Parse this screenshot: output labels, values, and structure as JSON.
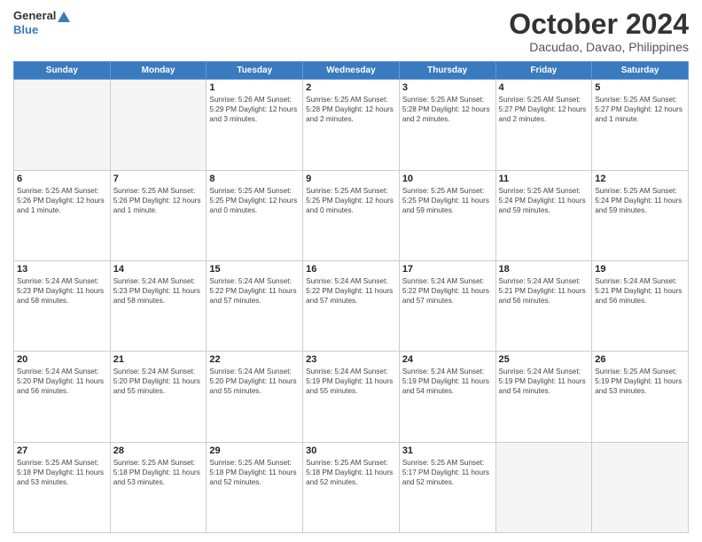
{
  "header": {
    "logo_line1": "General",
    "logo_line2": "Blue",
    "month": "October 2024",
    "location": "Dacudao, Davao, Philippines"
  },
  "weekdays": [
    "Sunday",
    "Monday",
    "Tuesday",
    "Wednesday",
    "Thursday",
    "Friday",
    "Saturday"
  ],
  "weeks": [
    [
      {
        "day": "",
        "info": ""
      },
      {
        "day": "",
        "info": ""
      },
      {
        "day": "1",
        "info": "Sunrise: 5:26 AM\nSunset: 5:29 PM\nDaylight: 12 hours\nand 3 minutes."
      },
      {
        "day": "2",
        "info": "Sunrise: 5:25 AM\nSunset: 5:28 PM\nDaylight: 12 hours\nand 2 minutes."
      },
      {
        "day": "3",
        "info": "Sunrise: 5:25 AM\nSunset: 5:28 PM\nDaylight: 12 hours\nand 2 minutes."
      },
      {
        "day": "4",
        "info": "Sunrise: 5:25 AM\nSunset: 5:27 PM\nDaylight: 12 hours\nand 2 minutes."
      },
      {
        "day": "5",
        "info": "Sunrise: 5:25 AM\nSunset: 5:27 PM\nDaylight: 12 hours\nand 1 minute."
      }
    ],
    [
      {
        "day": "6",
        "info": "Sunrise: 5:25 AM\nSunset: 5:26 PM\nDaylight: 12 hours\nand 1 minute."
      },
      {
        "day": "7",
        "info": "Sunrise: 5:25 AM\nSunset: 5:26 PM\nDaylight: 12 hours\nand 1 minute."
      },
      {
        "day": "8",
        "info": "Sunrise: 5:25 AM\nSunset: 5:25 PM\nDaylight: 12 hours\nand 0 minutes."
      },
      {
        "day": "9",
        "info": "Sunrise: 5:25 AM\nSunset: 5:25 PM\nDaylight: 12 hours\nand 0 minutes."
      },
      {
        "day": "10",
        "info": "Sunrise: 5:25 AM\nSunset: 5:25 PM\nDaylight: 11 hours\nand 59 minutes."
      },
      {
        "day": "11",
        "info": "Sunrise: 5:25 AM\nSunset: 5:24 PM\nDaylight: 11 hours\nand 59 minutes."
      },
      {
        "day": "12",
        "info": "Sunrise: 5:25 AM\nSunset: 5:24 PM\nDaylight: 11 hours\nand 59 minutes."
      }
    ],
    [
      {
        "day": "13",
        "info": "Sunrise: 5:24 AM\nSunset: 5:23 PM\nDaylight: 11 hours\nand 58 minutes."
      },
      {
        "day": "14",
        "info": "Sunrise: 5:24 AM\nSunset: 5:23 PM\nDaylight: 11 hours\nand 58 minutes."
      },
      {
        "day": "15",
        "info": "Sunrise: 5:24 AM\nSunset: 5:22 PM\nDaylight: 11 hours\nand 57 minutes."
      },
      {
        "day": "16",
        "info": "Sunrise: 5:24 AM\nSunset: 5:22 PM\nDaylight: 11 hours\nand 57 minutes."
      },
      {
        "day": "17",
        "info": "Sunrise: 5:24 AM\nSunset: 5:22 PM\nDaylight: 11 hours\nand 57 minutes."
      },
      {
        "day": "18",
        "info": "Sunrise: 5:24 AM\nSunset: 5:21 PM\nDaylight: 11 hours\nand 56 minutes."
      },
      {
        "day": "19",
        "info": "Sunrise: 5:24 AM\nSunset: 5:21 PM\nDaylight: 11 hours\nand 56 minutes."
      }
    ],
    [
      {
        "day": "20",
        "info": "Sunrise: 5:24 AM\nSunset: 5:20 PM\nDaylight: 11 hours\nand 56 minutes."
      },
      {
        "day": "21",
        "info": "Sunrise: 5:24 AM\nSunset: 5:20 PM\nDaylight: 11 hours\nand 55 minutes."
      },
      {
        "day": "22",
        "info": "Sunrise: 5:24 AM\nSunset: 5:20 PM\nDaylight: 11 hours\nand 55 minutes."
      },
      {
        "day": "23",
        "info": "Sunrise: 5:24 AM\nSunset: 5:19 PM\nDaylight: 11 hours\nand 55 minutes."
      },
      {
        "day": "24",
        "info": "Sunrise: 5:24 AM\nSunset: 5:19 PM\nDaylight: 11 hours\nand 54 minutes."
      },
      {
        "day": "25",
        "info": "Sunrise: 5:24 AM\nSunset: 5:19 PM\nDaylight: 11 hours\nand 54 minutes."
      },
      {
        "day": "26",
        "info": "Sunrise: 5:25 AM\nSunset: 5:19 PM\nDaylight: 11 hours\nand 53 minutes."
      }
    ],
    [
      {
        "day": "27",
        "info": "Sunrise: 5:25 AM\nSunset: 5:18 PM\nDaylight: 11 hours\nand 53 minutes."
      },
      {
        "day": "28",
        "info": "Sunrise: 5:25 AM\nSunset: 5:18 PM\nDaylight: 11 hours\nand 53 minutes."
      },
      {
        "day": "29",
        "info": "Sunrise: 5:25 AM\nSunset: 5:18 PM\nDaylight: 11 hours\nand 52 minutes."
      },
      {
        "day": "30",
        "info": "Sunrise: 5:25 AM\nSunset: 5:18 PM\nDaylight: 11 hours\nand 52 minutes."
      },
      {
        "day": "31",
        "info": "Sunrise: 5:25 AM\nSunset: 5:17 PM\nDaylight: 11 hours\nand 52 minutes."
      },
      {
        "day": "",
        "info": ""
      },
      {
        "day": "",
        "info": ""
      }
    ]
  ]
}
